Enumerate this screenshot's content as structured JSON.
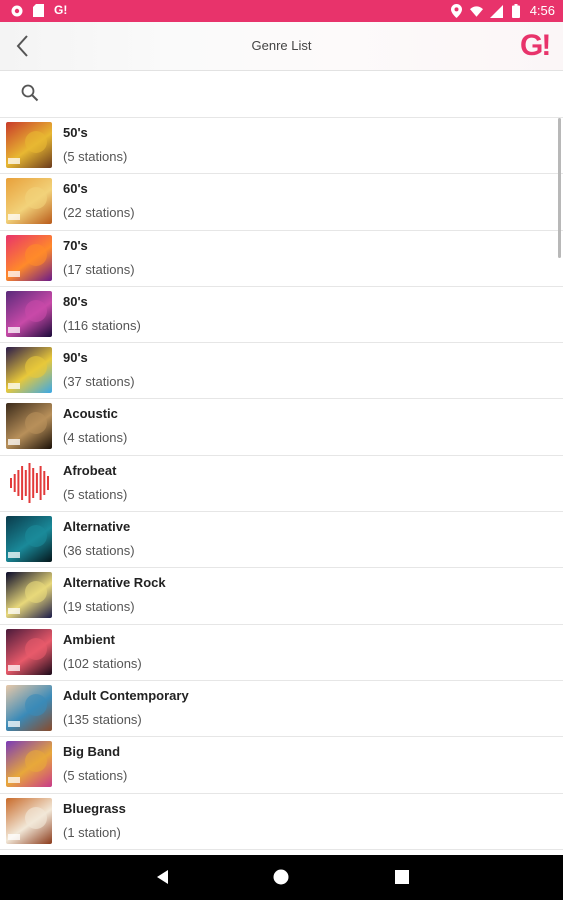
{
  "status_bar": {
    "time": "4:56",
    "left_icons": [
      "chrome-icon",
      "sd-card-icon",
      "app-logo-icon"
    ],
    "right_icons": [
      "location-icon",
      "wifi-icon",
      "signal-icon",
      "battery-icon"
    ],
    "left_logo_text": "G!"
  },
  "header": {
    "title": "Genre List",
    "logo_text": "G!",
    "back_icon": "back-arrow-icon"
  },
  "search": {
    "icon": "search-icon",
    "placeholder": ""
  },
  "genres": [
    {
      "name": "50's",
      "count": "(5 stations)",
      "colors": [
        "#c83a2a",
        "#e8b832",
        "#6a3a1c"
      ]
    },
    {
      "name": "60's",
      "count": "(22 stations)",
      "colors": [
        "#e8a03a",
        "#f2d27a",
        "#b85a1a"
      ]
    },
    {
      "name": "70's",
      "count": "(17 stations)",
      "colors": [
        "#e8336b",
        "#ff8a2a",
        "#6a1a8a"
      ]
    },
    {
      "name": "80's",
      "count": "(116 stations)",
      "colors": [
        "#5a2a7a",
        "#c84aa8",
        "#1a0a3a"
      ]
    },
    {
      "name": "90's",
      "count": "(37 stations)",
      "colors": [
        "#2a1a4a",
        "#e8c83a",
        "#3aa8e8"
      ]
    },
    {
      "name": "Acoustic",
      "count": "(4 stations)",
      "colors": [
        "#3a2a1a",
        "#b8905a",
        "#1a1008"
      ]
    },
    {
      "name": "Afrobeat",
      "count": "(5 stations)",
      "colors": [
        "#ffffff",
        "#e23a3a",
        "#ffffff"
      ]
    },
    {
      "name": "Alternative",
      "count": "(36 stations)",
      "colors": [
        "#0a3a4a",
        "#1a8a9a",
        "#05151a"
      ]
    },
    {
      "name": "Alternative Rock",
      "count": "(19 stations)",
      "colors": [
        "#0a0a2a",
        "#e8d87a",
        "#1a1a4a"
      ]
    },
    {
      "name": "Ambient",
      "count": "(102 stations)",
      "colors": [
        "#4a1a3a",
        "#e85a6a",
        "#1a0a1a"
      ]
    },
    {
      "name": "Adult Contemporary",
      "count": "(135 stations)",
      "colors": [
        "#e8c8a8",
        "#3a8ab8",
        "#8a4a2a"
      ]
    },
    {
      "name": "Big Band",
      "count": "(5 stations)",
      "colors": [
        "#7a3ab8",
        "#e8a83a",
        "#c83a8a"
      ]
    },
    {
      "name": "Bluegrass",
      "count": "(1 station)",
      "colors": [
        "#c86a2a",
        "#f2e8d8",
        "#8a3a1a"
      ]
    }
  ],
  "nav_bar": {
    "icons": [
      "back-triangle-icon",
      "home-circle-icon",
      "recents-square-icon"
    ]
  },
  "accent_color": "#e8336b"
}
